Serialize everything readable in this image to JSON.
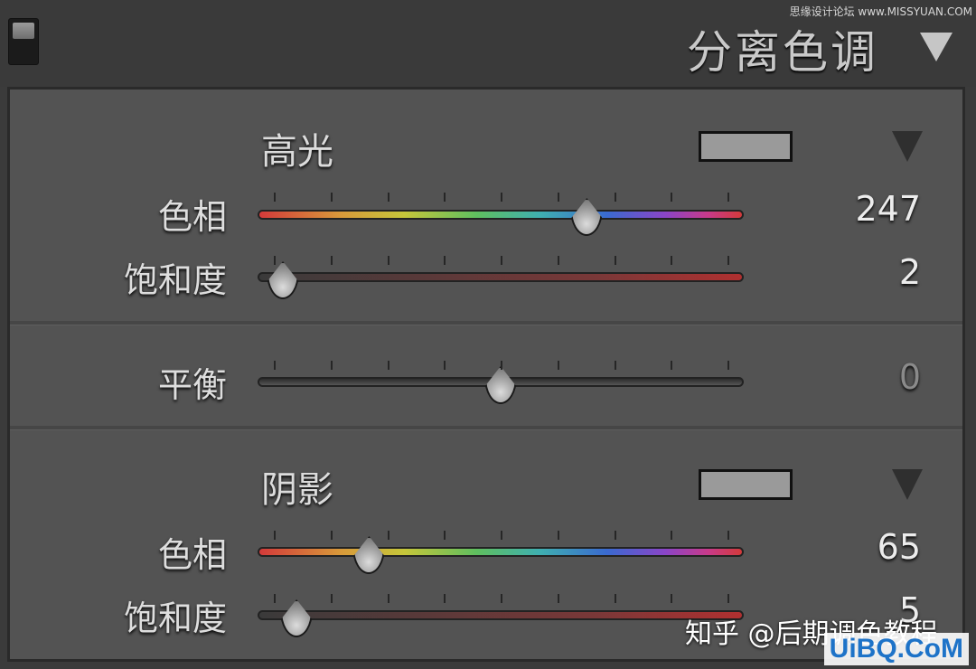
{
  "header": {
    "title": "分离色调",
    "credit": "思缘设计论坛 www.MISSYUAN.COM"
  },
  "highlights": {
    "title": "高光",
    "swatch_color": "#9a9a9a",
    "hue": {
      "label": "色相",
      "value": "247",
      "level": 0.69
    },
    "saturation": {
      "label": "饱和度",
      "value": "2",
      "level": 0.02
    }
  },
  "balance": {
    "label": "平衡",
    "value": "0",
    "level": 0.5
  },
  "shadows": {
    "title": "阴影",
    "swatch_color": "#9a9a9a",
    "hue": {
      "label": "色相",
      "value": "65",
      "level": 0.21
    },
    "saturation": {
      "label": "饱和度",
      "value": "5",
      "level": 0.05
    }
  },
  "watermark": "知乎 @后期调色教程",
  "corner_logo": "UiBQ.CoM",
  "icons": {
    "panel_toggle": "toggle-switch-icon",
    "collapse": "triangle-down-icon"
  }
}
